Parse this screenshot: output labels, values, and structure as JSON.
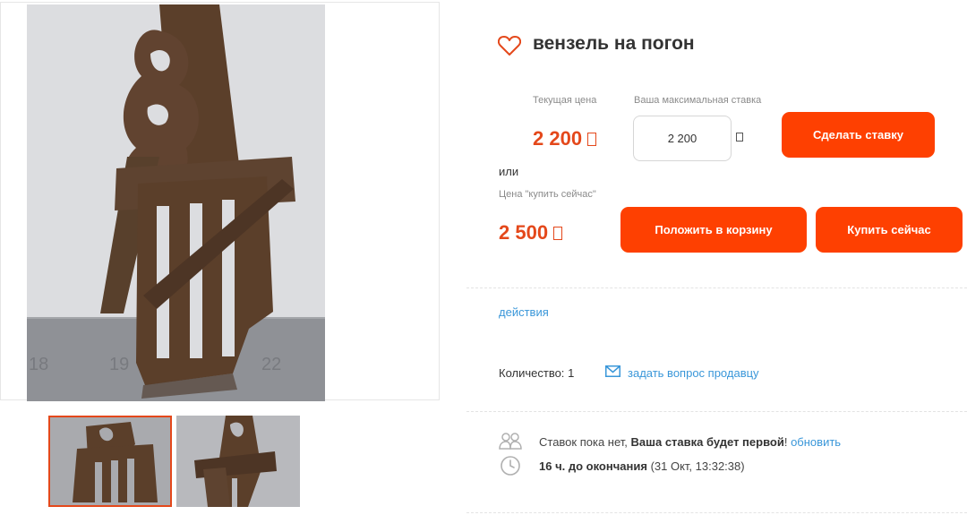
{
  "lot": {
    "title": "вензель на погон"
  },
  "bid": {
    "current_price_label": "Текущая цена",
    "current_price": "2 200",
    "max_bid_label": "Ваша максимальная ставка",
    "max_bid_value": "2 200",
    "place_bid_label": "Сделать ставку"
  },
  "buy_now": {
    "or_text": "или",
    "price_label": "Цена \"купить сейчас\"",
    "price": "2 500",
    "add_to_cart_label": "Положить в корзину",
    "buy_now_label": "Купить сейчас"
  },
  "actions": {
    "link_label": "действия"
  },
  "quantity": {
    "label": "Количество:",
    "value": "1",
    "ask_seller_label": "задать вопрос продавцу"
  },
  "status": {
    "no_bids_text": "Ставок пока нет,",
    "first_bid_text": "Ваша ставка будет первой",
    "exclamation": "!",
    "refresh_label": "обновить",
    "time_left": "16 ч. до окончания",
    "end_time": "(31 Окт, 13:32:38)"
  },
  "icons": {
    "favorite": "heart-outline-icon",
    "mail": "envelope-icon",
    "bidders": "users-icon",
    "time": "clock-icon",
    "currency": "ruble-glyph-box"
  },
  "colors": {
    "accent": "#fe4001",
    "price": "#e4481b",
    "link": "#3a97d9",
    "muted_text": "#8a8a8a",
    "thumb_active_border": "#e4481b"
  }
}
